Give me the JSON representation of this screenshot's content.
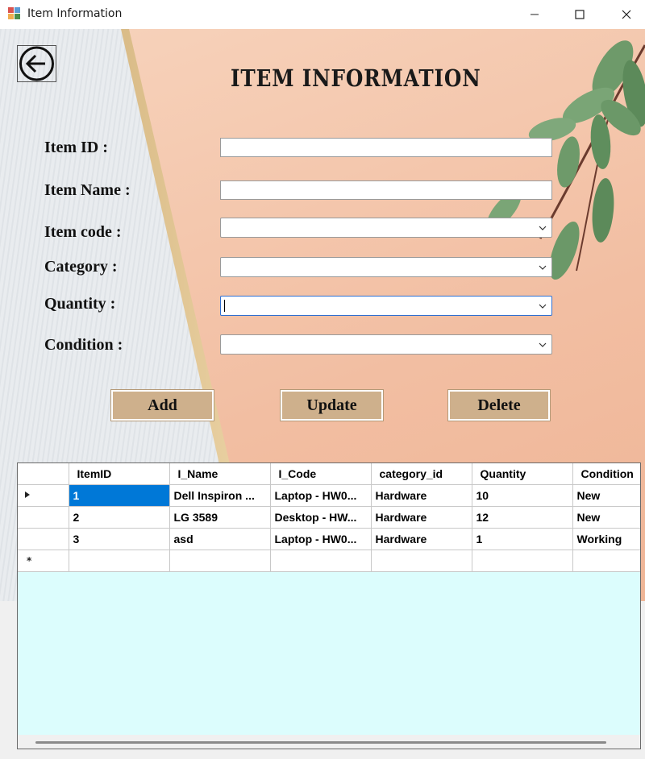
{
  "window": {
    "title": "Item Information"
  },
  "page": {
    "title": "ITEM INFORMATION"
  },
  "form": {
    "item_id_label": "Item ID :",
    "item_id_value": "",
    "item_name_label": "Item Name :",
    "item_name_value": "",
    "item_code_label": "Item code :",
    "item_code_value": "",
    "category_label": "Category :",
    "category_value": "",
    "quantity_label": "Quantity :",
    "quantity_value": "",
    "condition_label": "Condition :",
    "condition_value": ""
  },
  "buttons": {
    "add": "Add",
    "update": "Update",
    "delete": "Delete"
  },
  "grid": {
    "columns": [
      "ItemID",
      "I_Name",
      "I_Code",
      "category_id",
      "Quantity",
      "Condition"
    ],
    "rows": [
      [
        "1",
        "Dell Inspiron ...",
        "Laptop - HW0...",
        "Hardware",
        "10",
        "New"
      ],
      [
        "2",
        "LG 3589",
        "Desktop - HW...",
        "Hardware",
        "12",
        "New"
      ],
      [
        "3",
        "asd",
        "Laptop - HW0...",
        "Hardware",
        "1",
        "Working"
      ]
    ]
  },
  "colors": {
    "accent": "#0078d7",
    "button": "#ceb08c",
    "grid_background": "#dcfdfd"
  }
}
